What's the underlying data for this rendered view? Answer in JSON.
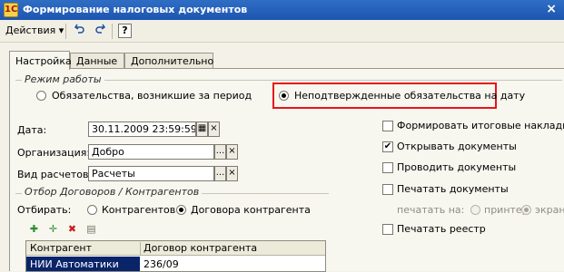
{
  "window": {
    "title": "Формирование налоговых документов",
    "close_label": "×"
  },
  "toolbar": {
    "actions_label": "Действия",
    "dropdown_glyph": "▾",
    "help_label": "?"
  },
  "tabs": [
    {
      "label": "Настройка",
      "active": true
    },
    {
      "label": "Данные",
      "active": false
    },
    {
      "label": "Дополнительно",
      "active": false
    }
  ],
  "mode": {
    "legend": "Режим работы",
    "options": [
      {
        "label": "Обязательства, возникшие за период",
        "selected": false
      },
      {
        "label": "Неподтвержденные обязательства на дату",
        "selected": true
      }
    ],
    "highlight_color": "#e4161b"
  },
  "fields": {
    "date_label": "Дата:",
    "date_value": "30.11.2009 23:59:59",
    "org_label": "Организация:",
    "org_value": "Добро",
    "calc_label": "Вид расчетов:",
    "calc_value": "Расчеты",
    "select_glyph": "...",
    "clear_glyph": "×"
  },
  "options": [
    {
      "label": "Формировать итоговые накладные",
      "checked": false
    },
    {
      "label": "Открывать документы",
      "checked": true
    },
    {
      "label": "Проводить документы",
      "checked": false
    },
    {
      "label": "Печатать документы",
      "checked": false
    }
  ],
  "print_on": {
    "label": "печатать на:",
    "options": [
      {
        "label": "принтер",
        "selected": false
      },
      {
        "label": "экран",
        "selected": true
      }
    ]
  },
  "print_registry": {
    "label": "Печатать реестр",
    "checked": false
  },
  "filter": {
    "legend": "Отбор Договоров / Контрагентов",
    "select_label": "Отбирать:",
    "options": [
      {
        "label": "Контрагентов",
        "selected": false
      },
      {
        "label": "Договора контрагента",
        "selected": true
      }
    ],
    "columns": [
      "Контрагент",
      "Договор контрагента"
    ],
    "rows": [
      {
        "contractor": "НИИ Автоматики",
        "contract": "236/09"
      }
    ]
  },
  "colors": {
    "title_bar": "#2f6ec6",
    "selection": "#0a246a"
  }
}
